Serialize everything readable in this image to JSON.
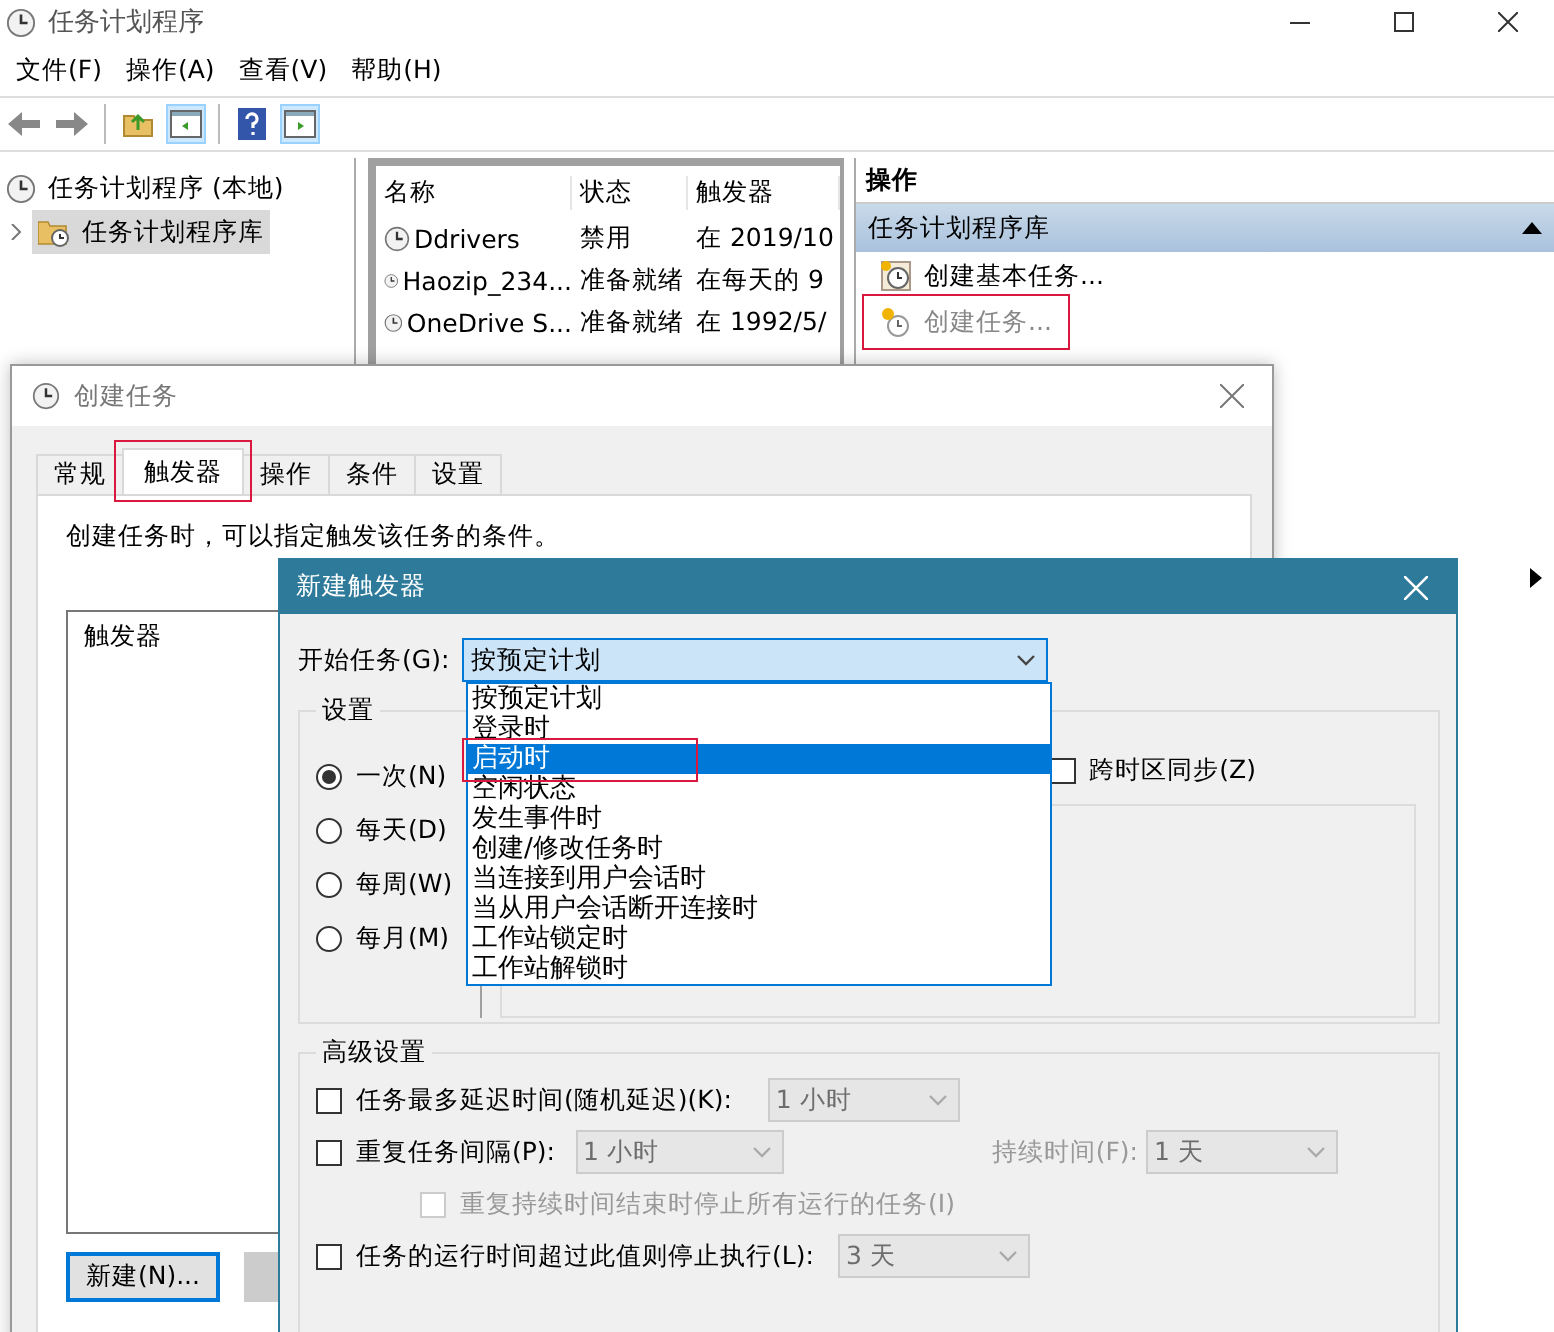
{
  "window": {
    "title": "任务计划程序"
  },
  "menu": [
    "文件(F)",
    "操作(A)",
    "查看(V)",
    "帮助(H)"
  ],
  "toolbar": {
    "toggles": [
      {
        "on": true
      },
      {
        "on": true
      }
    ]
  },
  "tree": [
    {
      "label": "任务计划程序 (本地)",
      "selected": false,
      "children": [
        {
          "label": "任务计划程序库",
          "selected": true,
          "expanded": false
        }
      ]
    }
  ],
  "task_list": {
    "columns": [
      "名称",
      "状态",
      "触发器"
    ],
    "rows": [
      {
        "name": "Ddrivers",
        "status": "禁用",
        "trigger": "在 2019/10"
      },
      {
        "name": "Haozip_234...",
        "status": "准备就绪",
        "trigger": "在每天的 9"
      },
      {
        "name": "OneDrive S...",
        "status": "准备就绪",
        "trigger": "在 1992/5/"
      }
    ]
  },
  "actions_pane": {
    "title": "操作",
    "section": "任务计划程序库",
    "items": [
      {
        "kind": "basic",
        "label": "创建基本任务...",
        "disabled": false,
        "highlighted": false
      },
      {
        "kind": "task",
        "label": "创建任务...",
        "disabled": true,
        "highlighted": true
      }
    ]
  },
  "create_task_dialog": {
    "title": "创建任务",
    "tabs": [
      {
        "label": "常规",
        "selected": false,
        "highlighted": false
      },
      {
        "label": "触发器",
        "selected": true,
        "highlighted": true
      },
      {
        "label": "操作",
        "selected": false,
        "highlighted": false
      },
      {
        "label": "条件",
        "selected": false,
        "highlighted": false
      },
      {
        "label": "设置",
        "selected": false,
        "highlighted": false
      }
    ],
    "description": "创建任务时，可以指定触发该任务的条件。",
    "list_header": "触发器",
    "new_button": "新建(N)..."
  },
  "new_trigger_dialog": {
    "title": "新建触发器",
    "start_label": "开始任务(G):",
    "start_value": "按预定计划",
    "dropdown": {
      "expanded": true,
      "options": [
        {
          "label": "按预定计划",
          "selected": false,
          "highlighted": false
        },
        {
          "label": "登录时",
          "selected": false,
          "highlighted": false
        },
        {
          "label": "启动时",
          "selected": true,
          "highlighted": true
        },
        {
          "label": "空闲状态",
          "selected": false,
          "highlighted": false
        },
        {
          "label": "发生事件时",
          "selected": false,
          "highlighted": false
        },
        {
          "label": "创建/修改任务时",
          "selected": false,
          "highlighted": false
        },
        {
          "label": "当连接到用户会话时",
          "selected": false,
          "highlighted": false
        },
        {
          "label": "当从用户会话断开连接时",
          "selected": false,
          "highlighted": false
        },
        {
          "label": "工作站锁定时",
          "selected": false,
          "highlighted": false
        },
        {
          "label": "工作站解锁时",
          "selected": false,
          "highlighted": false
        }
      ]
    },
    "settings": {
      "title": "设置",
      "schedules": [
        {
          "label": "一次(N)",
          "selected": true
        },
        {
          "label": "每天(D)",
          "selected": false
        },
        {
          "label": "每周(W)",
          "selected": false
        },
        {
          "label": "每月(M)",
          "selected": false
        }
      ],
      "sync_timezone": {
        "label": "跨时区同步(Z)",
        "checked": false
      }
    },
    "advanced": {
      "title": "高级设置",
      "delay": {
        "label": "任务最多延迟时间(随机延迟)(K):",
        "checked": false,
        "value": "1 小时"
      },
      "repeat": {
        "label": "重复任务间隔(P):",
        "checked": false,
        "value": "1 小时",
        "duration_label": "持续时间(F):",
        "duration_value": "1 天"
      },
      "stop_repeat": {
        "label": "重复持续时间结束时停止所有运行的任务(I)",
        "checked": false,
        "disabled": true
      },
      "stop_after": {
        "label": "任务的运行时间超过此值则停止执行(L):",
        "checked": false,
        "value": "3 天"
      }
    }
  }
}
